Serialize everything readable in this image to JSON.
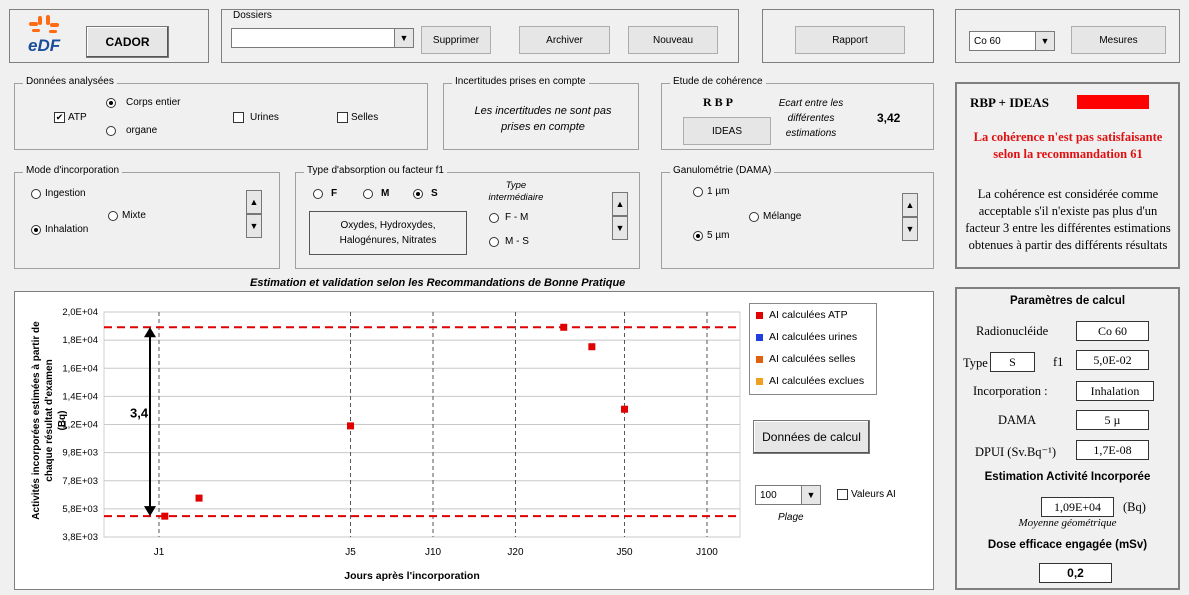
{
  "header": {
    "logo_text": "eDF",
    "app_button": "CADOR",
    "dossiers_label": "Dossiers",
    "dossiers_value": "",
    "delete_button": "Supprimer",
    "archive_button": "Archiver",
    "new_button": "Nouveau",
    "report_button": "Rapport",
    "nuclide_select": "Co 60",
    "measures_button": "Mesures"
  },
  "analyzed_data": {
    "title": "Données analysées",
    "atp": "ATP",
    "atp_checked": true,
    "body_whole": "Corps entier",
    "organ": "organe",
    "urines": "Urines",
    "selles": "Selles"
  },
  "uncertainties": {
    "title": "Incertitudes prises en compte",
    "text": "Les incertitudes ne sont pas prises en compte"
  },
  "coherence": {
    "title": "Etude  de cohérence",
    "rbp": "R B P",
    "ideas_button": "IDEAS",
    "gap_label": "Ecart entre les différentes estimations",
    "gap_value": "3,42"
  },
  "incorporation_mode": {
    "title": "Mode d'incorporation",
    "ingestion": "Ingestion",
    "mixed": "Mixte",
    "inhalation": "Inhalation",
    "selected": "Inhalation"
  },
  "absorption": {
    "title": "Type d'absorption  ou facteur f1",
    "f": "F",
    "m": "M",
    "s": "S",
    "selected": "S",
    "intermediate_title": "Type intermédiaire",
    "fm": "F - M",
    "ms": "M - S",
    "description": "Oxydes, Hydroxydes, Halogénures, Nitrates"
  },
  "granulometry": {
    "title": "Ganulométrie  (DAMA)",
    "um1": "1 µm",
    "mix": "Mélange",
    "um5": "5 µm",
    "selected": "5 µm"
  },
  "result_panel": {
    "title": "RBP + IDEAS",
    "status_color": "#ff0000",
    "warning": "La cohérence n'est pas satisfaisante selon la recommandation 61",
    "explanation": "La cohérence est considérée comme acceptable s'il n'existe pas plus d'un facteur 3 entre les différentes estimations obtenues à partir des différents résultats"
  },
  "chart_section": {
    "title": "Estimation et validation selon les Recommandations de Bonne Pratique",
    "calc_button": "Données de calcul",
    "range_value": "100",
    "range_label": "Plage",
    "ai_values_label": "Valeurs AI",
    "ratio_label": "3,4"
  },
  "chart_data": {
    "type": "scatter",
    "ylabel": "Activités  incorporées  estimées  à partir de chaque  résultat  d'examen (Bq)",
    "xlabel": "Jours après l'incorporation",
    "y_ticks": [
      "2,0E+04",
      "1,8E+04",
      "1,6E+04",
      "1,4E+04",
      "1,2E+04",
      "9,8E+03",
      "7,8E+03",
      "5,8E+03",
      "3,8E+03"
    ],
    "x_ticks": [
      "J1",
      "J5",
      "J10",
      "J20",
      "J50",
      "J100"
    ],
    "x_tick_values": [
      1,
      5,
      10,
      20,
      50,
      100
    ],
    "x_scale": "log",
    "ylim": [
      3800,
      20000
    ],
    "grid": true,
    "legend": [
      "AI calculées ATP",
      "AI calculées urines",
      "AI calculées selles",
      "AI calculées exclues"
    ],
    "legend_colors": [
      "#e00000",
      "#1f3fe0",
      "#e06010",
      "#f0a020"
    ],
    "points": [
      {
        "x": 1.05,
        "y": 5300
      },
      {
        "x": 1.4,
        "y": 6600
      },
      {
        "x": 5.0,
        "y": 11800
      },
      {
        "x": 30,
        "y": 18900
      },
      {
        "x": 38,
        "y": 17500
      },
      {
        "x": 50,
        "y": 13000
      }
    ],
    "max_line": 18900,
    "min_line": 5300,
    "ratio": "3,4"
  },
  "params": {
    "title": "Paramètres de calcul",
    "nuclide_label": "Radionucléide",
    "nuclide_value": "Co 60",
    "type_label": "Type",
    "type_value": "S",
    "f1_label": "f1",
    "f1_value": "5,0E-02",
    "incorp_label": "Incorporation :",
    "incorp_value": "Inhalation",
    "dama_label": "DAMA",
    "dama_value": "5 µ",
    "dpui_label": "DPUI (Sv.Bq⁻¹)",
    "dpui_value": "1,7E-08",
    "estimation_title": "Estimation Activité Incorporée",
    "activity_value": "1,09E+04",
    "activity_unit": "(Bq)",
    "geo_mean": "Moyenne géométrique",
    "dose_title": "Dose efficace engagée (mSv)",
    "dose_value": "0,2"
  }
}
